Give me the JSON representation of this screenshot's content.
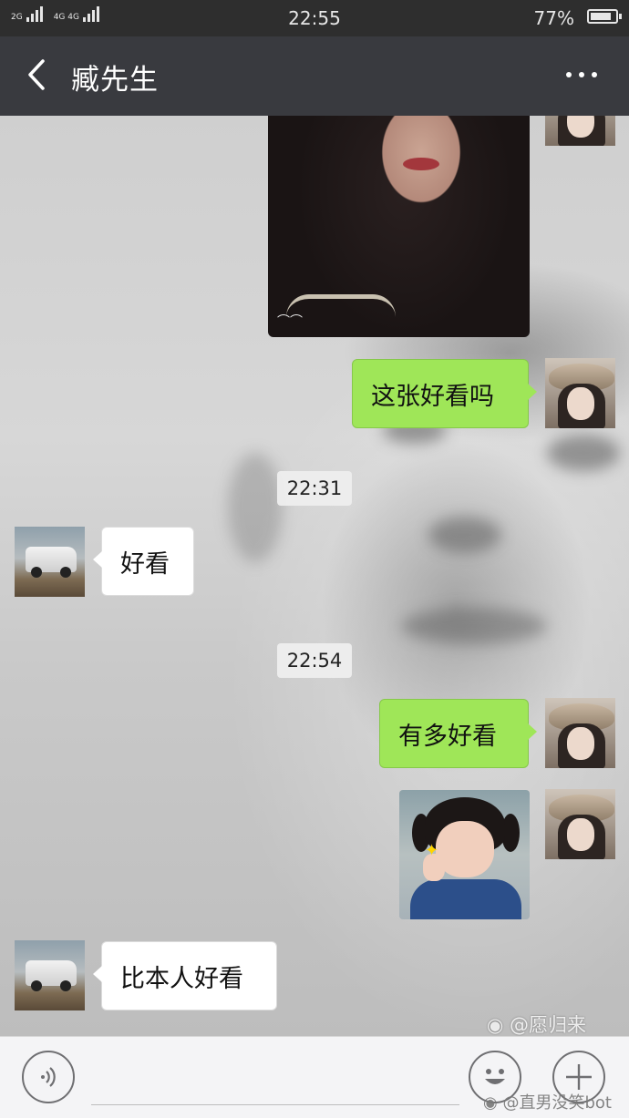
{
  "status_bar": {
    "signal_1_label": "2G",
    "signal_2_label": "4G 4G",
    "time": "22:55",
    "battery_percent": "77%"
  },
  "header": {
    "title": "臧先生",
    "back_icon": "chevron-left-icon",
    "more_icon": "more-dots-icon"
  },
  "messages": {
    "self_text_1": "这张好看吗",
    "time_1": "22:31",
    "other_text_1": "好看",
    "time_2": "22:54",
    "self_text_2": "有多好看",
    "other_text_2": "比本人好看"
  },
  "watermarks": {
    "weibo_1": "@愿归来",
    "weibo_2": "@直男没笑bot"
  },
  "input_bar": {
    "voice_icon": "voice-icon",
    "emoji_icon": "emoji-icon",
    "plus_icon": "plus-icon",
    "text_value": ""
  },
  "colors": {
    "self_bubble": "#9fe658",
    "other_bubble": "#ffffff",
    "title_bar": "#393a3f",
    "status_bar": "#2e2e2e"
  }
}
